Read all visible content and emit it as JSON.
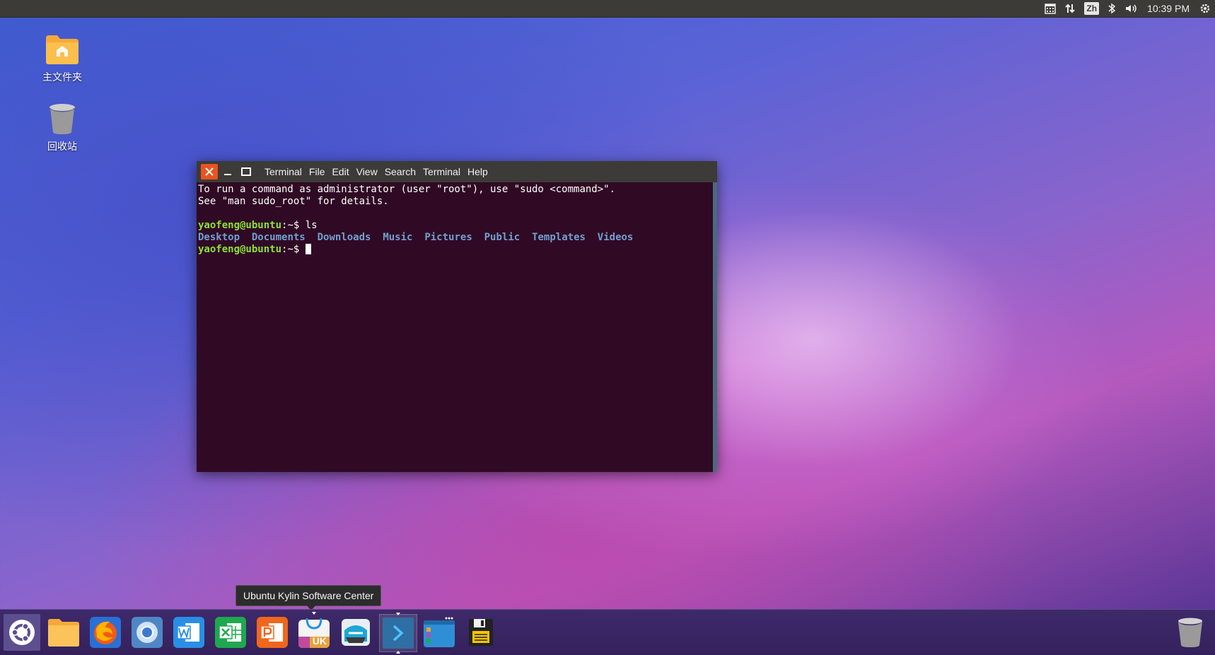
{
  "top_panel": {
    "input_method": "Zh",
    "clock": "10:39 PM",
    "tray_icons": [
      "calendar-icon",
      "network-arrows-icon",
      "input-method-icon",
      "bluetooth-icon",
      "volume-icon",
      "gear-icon"
    ]
  },
  "desktop": {
    "icons": [
      {
        "label": "主文件夹",
        "icon": "home-folder-icon"
      },
      {
        "label": "回收站",
        "icon": "trash-icon"
      }
    ]
  },
  "terminal": {
    "menu": [
      "Terminal",
      "File",
      "Edit",
      "View",
      "Search",
      "Terminal",
      "Help"
    ],
    "lines": {
      "sudo_hint_1": "To run a command as administrator (user \"root\"), use \"sudo <command>\".",
      "sudo_hint_2": "See \"man sudo_root\" for details.",
      "prompt_user": "yaofeng@ubuntu",
      "prompt_suffix": ":~$ ",
      "command": "ls"
    },
    "ls_output": [
      "Desktop",
      "Documents",
      "Downloads",
      "Music",
      "Pictures",
      "Public",
      "Templates",
      "Videos"
    ],
    "colors": {
      "background": "#300a24",
      "prompt": "#8ae234",
      "directory": "#729fcf"
    }
  },
  "tooltip": "Ubuntu Kylin Software Center",
  "dock": {
    "items": [
      "ubuntu-logo-icon",
      "files-icon",
      "firefox-icon",
      "chromium-icon",
      "wps-writer-icon",
      "wps-spreadsheet-icon",
      "wps-presentation-icon",
      "software-center-icon",
      "scanner-icon",
      "terminal-icon",
      "workspace-switcher-icon",
      "save-icon"
    ],
    "software_center_badge": "UK",
    "trash": "trash-icon"
  }
}
